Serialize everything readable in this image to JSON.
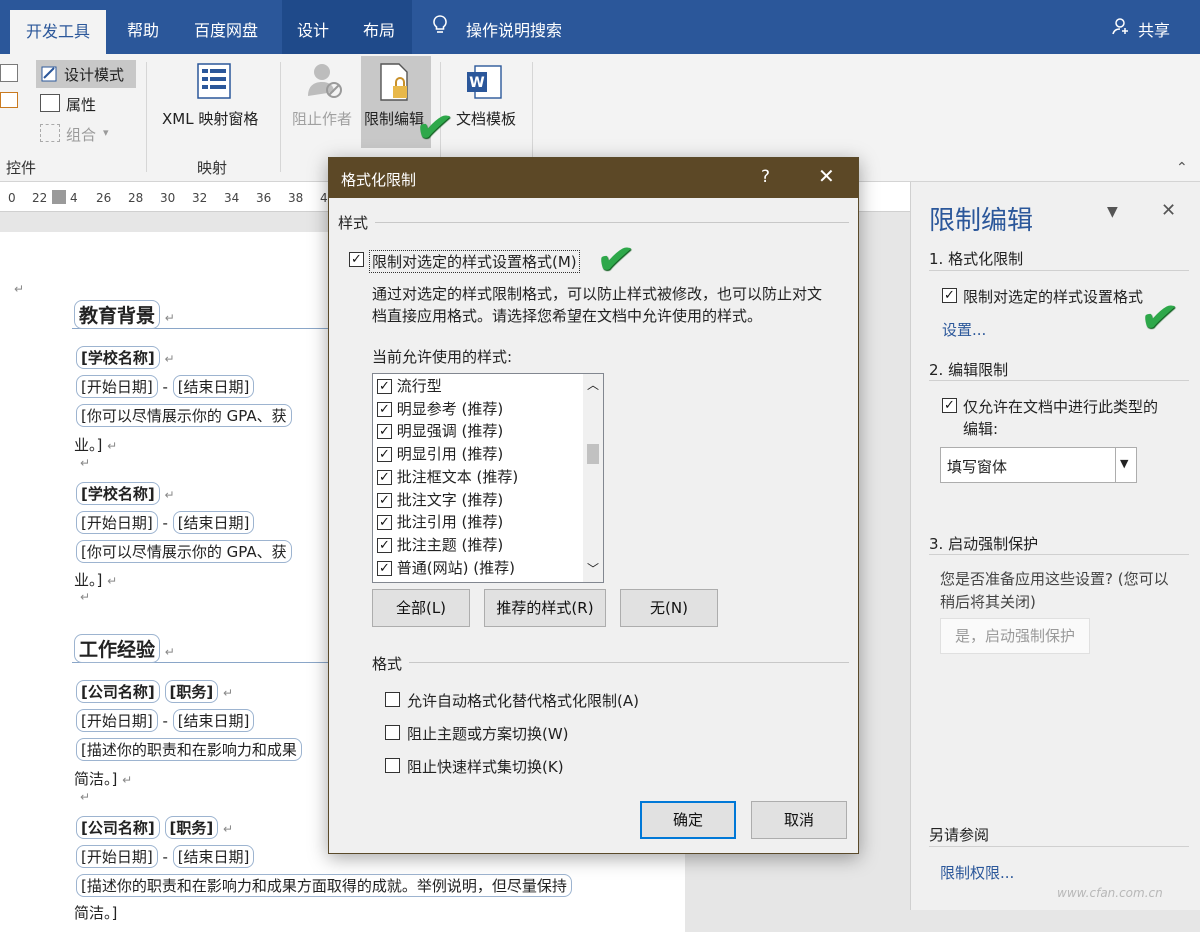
{
  "tabs": [
    "开发工具",
    "帮助",
    "百度网盘",
    "设计",
    "布局",
    "操作说明搜索"
  ],
  "share": "共享",
  "ribbon": {
    "design_mode": "设计模式",
    "properties": "属性",
    "group": "组合",
    "controls_group": "控件",
    "xml_pane": "XML 映射窗格",
    "mapping_group": "映射",
    "block_authors": "阻止作者",
    "restrict_editing": "限制编辑",
    "doc_template": "文档模板"
  },
  "ruler": [
    "0",
    "22",
    "4",
    "26",
    "28",
    "30",
    "32",
    "34",
    "36",
    "38",
    "4"
  ],
  "document": {
    "education": "教育背景",
    "school": "[学校名称]",
    "start_date": "[开始日期]",
    "dash": "-",
    "end_date": "[结束日期]",
    "gpa_text": "[你可以尽情展示你的 GPA、获",
    "ye": "业。]",
    "work": "工作经验",
    "company": "[公司名称]",
    "position": "[职务]",
    "duty_text": "[描述你的职责和在影响力和成果",
    "duty_full": "[描述你的职责和在影响力和成果方面取得的成就。举例说明，但尽量保持",
    "jianjie": "简洁。]",
    "jianjie2": "简洁。]"
  },
  "dialog": {
    "title": "格式化限制",
    "help": "?",
    "styles_section": "样式",
    "limit_label": "限制对选定的样式设置格式(M)",
    "desc_line1": "通过对选定的样式限制格式，可以防止样式被修改，也可以防止对文",
    "desc_line2": "档直接应用格式。请选择您希望在文档中允许使用的样式。",
    "allowed_label": "当前允许使用的样式:",
    "styles": [
      "流行型",
      "明显参考 (推荐)",
      "明显强调 (推荐)",
      "明显引用 (推荐)",
      "批注框文本 (推荐)",
      "批注文字 (推荐)",
      "批注引用 (推荐)",
      "批注主题 (推荐)",
      "普通(网站) (推荐)"
    ],
    "btn_all": "全部(L)",
    "btn_recommended": "推荐的样式(R)",
    "btn_none": "无(N)",
    "format_section": "格式",
    "opt1": "允许自动格式化替代格式化限制(A)",
    "opt2": "阻止主题或方案切换(W)",
    "opt3": "阻止快速样式集切换(K)",
    "ok": "确定",
    "cancel": "取消"
  },
  "pane": {
    "title": "限制编辑",
    "s1": "1. 格式化限制",
    "s1_check": "限制对选定的样式设置格式",
    "settings": "设置...",
    "s2": "2. 编辑限制",
    "s2_check_l1": "仅允许在文档中进行此类型的",
    "s2_check_l2": "编辑:",
    "edit_type": "填写窗体",
    "s3": "3. 启动强制保护",
    "s3_q1": "您是否准备应用这些设置? (您可以",
    "s3_q2": "稍后将其关闭)",
    "s3_btn": "是，启动强制保护",
    "see_also": "另请参阅",
    "perm": "限制权限...",
    "watermark": "www.cfan.com.cn"
  }
}
